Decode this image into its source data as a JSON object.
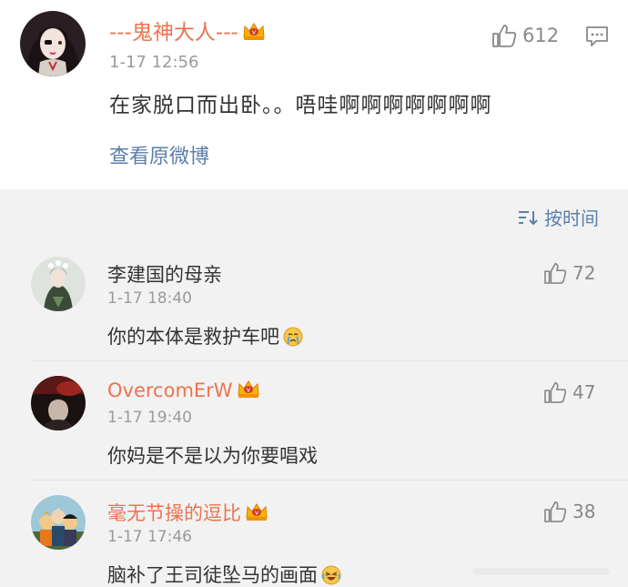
{
  "post": {
    "username": "---鬼神大人---",
    "time": "1-17 12:56",
    "content": "在家脱口而出卧。。唔哇啊啊啊啊啊啊啊",
    "likes": "612",
    "view_original_label": "查看原微博"
  },
  "sort": {
    "label": "按时间"
  },
  "comments": [
    {
      "username": "李建国的母亲",
      "time": "1-17 18:40",
      "text": "你的本体是救护车吧",
      "likes": "72",
      "verified": false,
      "emoji": "crying-face-emoji"
    },
    {
      "username": "OvercomErW",
      "time": "1-17 19:40",
      "text": "你妈是不是以为你要唱戏",
      "likes": "47",
      "verified": true
    },
    {
      "username": "毫无节操的逗比",
      "time": "1-17 17:46",
      "text": "脑补了王司徒坠马的画面",
      "likes": "38",
      "verified": true,
      "emoji": "laughing-tears-emoji"
    }
  ],
  "colors": {
    "vip_username": "#eb7350",
    "normal_username": "#333333",
    "link": "#5b7fa8",
    "meta": "#9a9a9a",
    "section_bg": "#f2f2f2"
  }
}
